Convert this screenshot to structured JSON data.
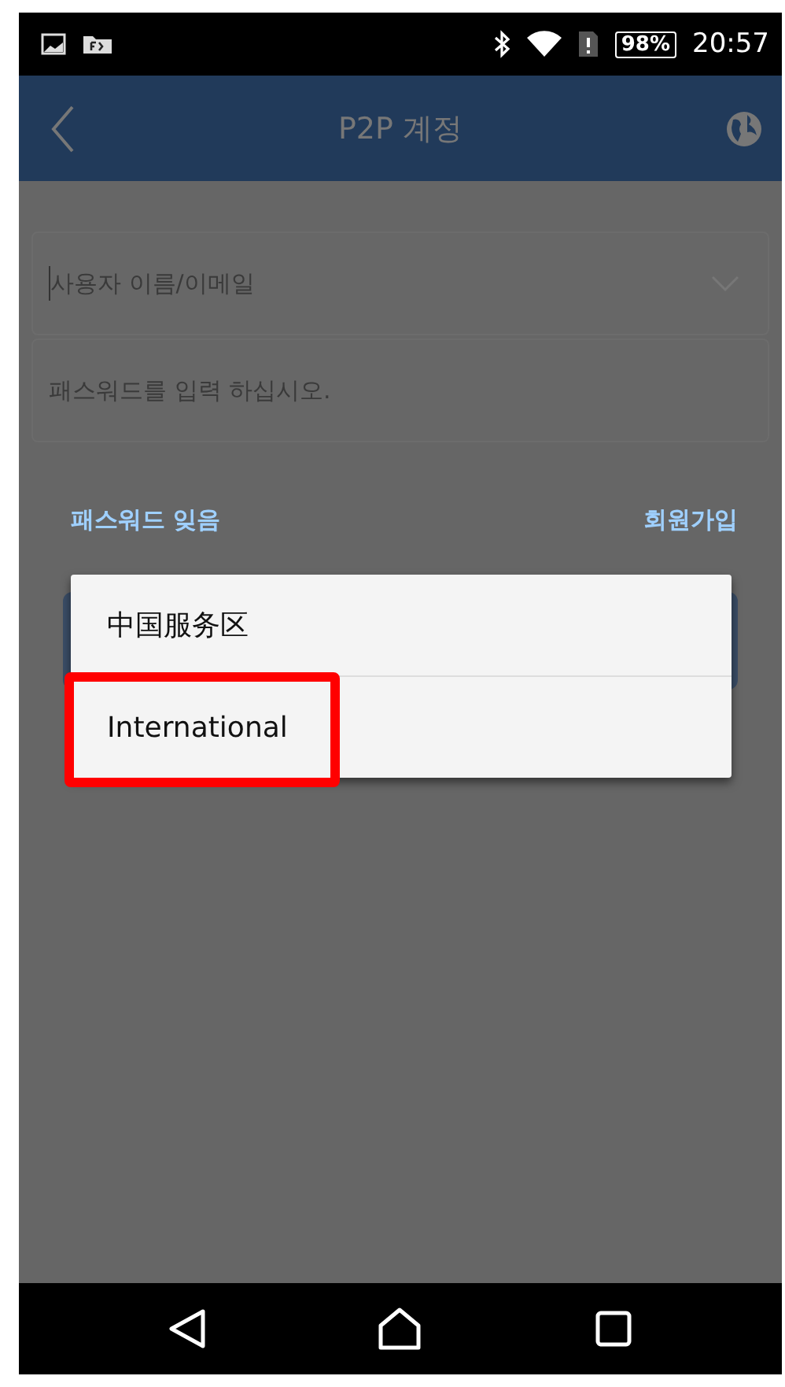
{
  "status_bar": {
    "battery": "98%",
    "time": "20:57"
  },
  "header": {
    "title": "P2P 계정"
  },
  "form": {
    "username": {
      "placeholder": "사용자 이름/이메일"
    },
    "password": {
      "placeholder": "패스워드를 입력 하십시오."
    },
    "links": [
      "패스워드 잊음",
      "회원가입"
    ]
  },
  "server_menu": {
    "items": [
      {
        "label": "中国服务区",
        "highlighted": false
      },
      {
        "label": "International",
        "highlighted": true
      }
    ]
  }
}
